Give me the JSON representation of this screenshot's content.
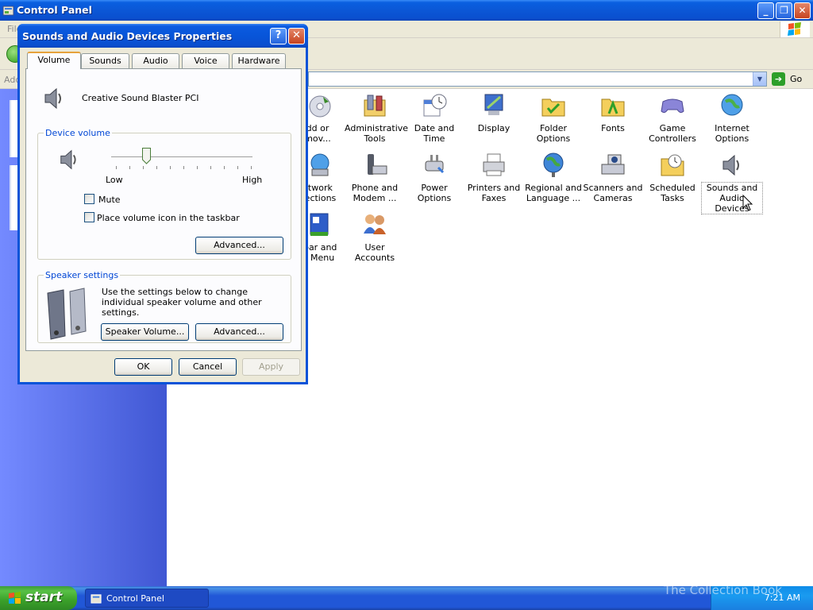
{
  "window": {
    "title": "Control Panel",
    "menu_file": "File",
    "address_label": "Address",
    "go_label": "Go"
  },
  "icons": [
    {
      "label": "dd or\nmov...",
      "icon": "add-remove-programs-icon"
    },
    {
      "label": "Administrative\nTools",
      "icon": "administrative-tools-icon"
    },
    {
      "label": "Date and Time",
      "icon": "date-time-icon"
    },
    {
      "label": "Display",
      "icon": "display-icon"
    },
    {
      "label": "Folder Options",
      "icon": "folder-options-icon"
    },
    {
      "label": "Fonts",
      "icon": "fonts-icon"
    },
    {
      "label": "Game\nControllers",
      "icon": "game-controllers-icon"
    },
    {
      "label": "Internet\nOptions",
      "icon": "internet-options-icon"
    },
    {
      "label": "etwork\nnections",
      "icon": "network-connections-icon"
    },
    {
      "label": "Phone and\nModem ...",
      "icon": "phone-modem-icon"
    },
    {
      "label": "Power Options",
      "icon": "power-options-icon"
    },
    {
      "label": "Printers and\nFaxes",
      "icon": "printers-faxes-icon"
    },
    {
      "label": "Regional and\nLanguage ...",
      "icon": "regional-language-icon"
    },
    {
      "label": "Scanners and\nCameras",
      "icon": "scanners-cameras-icon"
    },
    {
      "label": "Scheduled\nTasks",
      "icon": "scheduled-tasks-icon"
    },
    {
      "label": "Sounds and\nAudio Devices",
      "icon": "sounds-audio-icon"
    },
    {
      "label": "kbar and\nrt Menu",
      "icon": "taskbar-start-menu-icon"
    },
    {
      "label": "User Accounts",
      "icon": "user-accounts-icon"
    }
  ],
  "dialog": {
    "title": "Sounds and Audio Devices Properties",
    "help": "?",
    "tabs": [
      "Volume",
      "Sounds",
      "Audio",
      "Voice",
      "Hardware"
    ],
    "device_name": "Creative Sound Blaster PCI",
    "device_volume_legend": "Device volume",
    "volume_low": "Low",
    "volume_high": "High",
    "volume_level": 0.25,
    "mute_label": "Mute",
    "mute_checked": false,
    "taskbar_icon_label": "Place volume icon in the taskbar",
    "taskbar_icon_checked": false,
    "advanced_label": "Advanced...",
    "speaker_legend": "Speaker settings",
    "speaker_desc": "Use the settings below to change individual speaker volume and other settings.",
    "speaker_volume_label": "Speaker Volume...",
    "speaker_advanced_label": "Advanced...",
    "ok_label": "OK",
    "cancel_label": "Cancel",
    "apply_label": "Apply"
  },
  "taskbar": {
    "start_label": "start",
    "task_label": "Control Panel",
    "clock": "7:21 AM",
    "watermark": "The Collection Book"
  },
  "colors": {
    "titlebar": "#0a55d9",
    "taskpane": "#5a70e8",
    "taskbar": "#2157d7",
    "start": "#3aa02a",
    "legend": "#0046d5"
  }
}
